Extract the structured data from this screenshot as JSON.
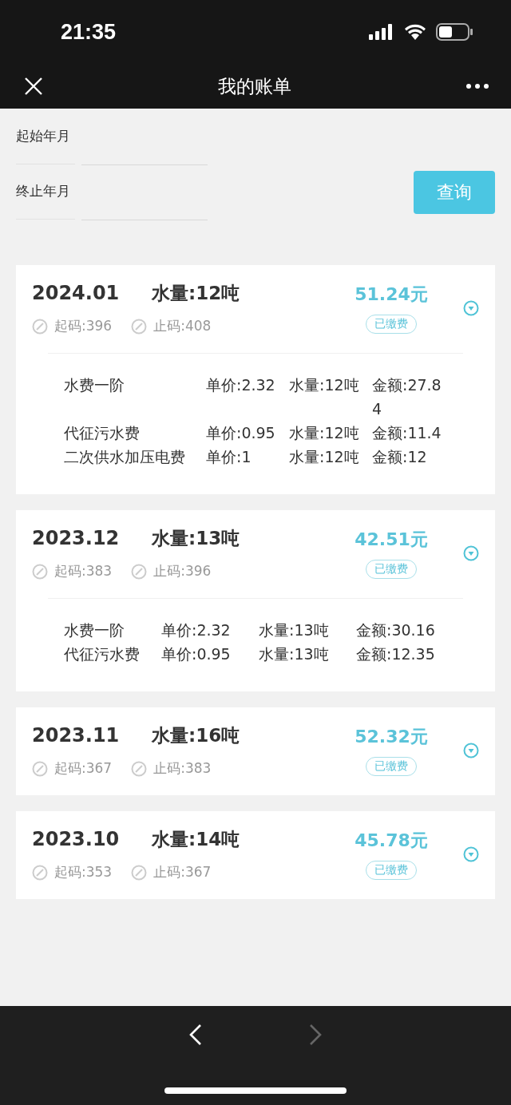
{
  "status_bar": {
    "time": "21:35"
  },
  "nav_bar": {
    "title": "我的账单"
  },
  "filter": {
    "fields": [
      {
        "label": "起始年月"
      },
      {
        "label": "终止年月"
      }
    ],
    "button": "查询"
  },
  "bills": [
    {
      "month": "2024.01",
      "usage": "水量:12吨",
      "amount": "51.24元",
      "start_reading": "起码:396",
      "end_reading": "止码:408",
      "status": "已缴费",
      "items": [
        {
          "name": "水费一阶",
          "price": "单价:2.32",
          "usage": "水量:12吨",
          "amount": "金额:27.84"
        },
        {
          "name": "代征污水费",
          "price": "单价:0.95",
          "usage": "水量:12吨",
          "amount": "金额:11.4"
        },
        {
          "name": "二次供水加压电费",
          "price": "单价:1",
          "usage": "水量:12吨",
          "amount": "金额:12"
        }
      ]
    },
    {
      "month": "2023.12",
      "usage": "水量:13吨",
      "amount": "42.51元",
      "start_reading": "起码:383",
      "end_reading": "止码:396",
      "status": "已缴费",
      "items": [
        {
          "name": "水费一阶",
          "price": "单价:2.32",
          "usage": "水量:13吨",
          "amount": "金额:30.16"
        },
        {
          "name": "代征污水费",
          "price": "单价:0.95",
          "usage": "水量:13吨",
          "amount": "金额:12.35"
        }
      ]
    },
    {
      "month": "2023.11",
      "usage": "水量:16吨",
      "amount": "52.32元",
      "start_reading": "起码:367",
      "end_reading": "止码:383",
      "status": "已缴费"
    },
    {
      "month": "2023.10",
      "usage": "水量:14吨",
      "amount": "45.78元",
      "start_reading": "起码:353",
      "end_reading": "止码:367",
      "status": "已缴费"
    }
  ],
  "toolbar": {
    "back_disabled": false,
    "forward_disabled": true
  }
}
